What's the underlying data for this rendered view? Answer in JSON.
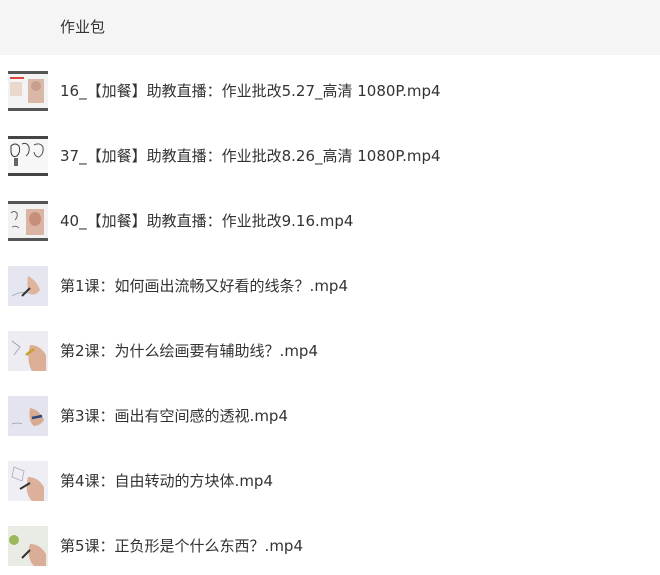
{
  "header": {
    "title": "作业包"
  },
  "files": [
    {
      "name": "16_【加餐】助教直播：作业批改5.27_高清 1080P.mp4",
      "thumb": "live-slide"
    },
    {
      "name": "37_【加餐】助教直播：作业批改8.26_高清 1080P.mp4",
      "thumb": "live-sketches"
    },
    {
      "name": "40_【加餐】助教直播：作业批改9.16.mp4",
      "thumb": "live-portrait"
    },
    {
      "name": "第1课：如何画出流畅又好看的线条？.mp4",
      "thumb": "hand-drawing"
    },
    {
      "name": "第2课：为什么绘画要有辅助线？.mp4",
      "thumb": "hand-drawing"
    },
    {
      "name": "第3课：画出有空间感的透视.mp4",
      "thumb": "hand-drawing"
    },
    {
      "name": "第4课：自由转动的方块体.mp4",
      "thumb": "hand-drawing"
    },
    {
      "name": "第5课：正负形是个什么东西？.mp4",
      "thumb": "hand-drawing"
    }
  ]
}
